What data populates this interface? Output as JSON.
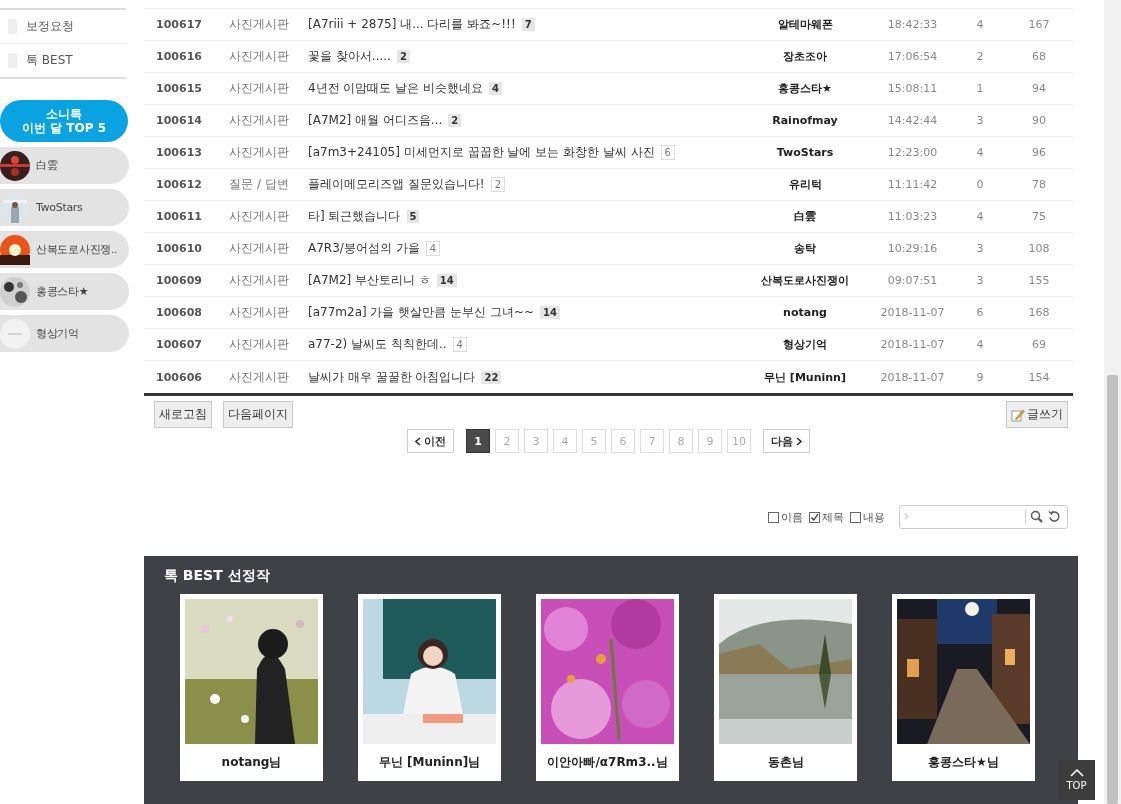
{
  "sidebar": {
    "menu": [
      {
        "label": "보정요청"
      },
      {
        "label": "톡 BEST"
      }
    ],
    "top5": {
      "title_line1": "소니톡",
      "title_line2": "이번 달 TOP 5",
      "members": [
        {
          "name": "白雲"
        },
        {
          "name": "TwoStars"
        },
        {
          "name": "산복도로사진쟁.."
        },
        {
          "name": "홍콩스타★"
        },
        {
          "name": "형상기억"
        }
      ]
    }
  },
  "board": {
    "rows": [
      {
        "number": "100617",
        "category": "사진게시판",
        "title": "[A7riii + 2875] 내... 다리를 봐죠~!!!",
        "comments": "7",
        "highlight": true,
        "author": "알테마웨폰",
        "time": "18:42:33",
        "votes": "4",
        "views": "167"
      },
      {
        "number": "100616",
        "category": "사진게시판",
        "title": "꽃을 찾아서.....",
        "comments": "2",
        "highlight": true,
        "author": "장초조아",
        "time": "17:06:54",
        "votes": "2",
        "views": "68"
      },
      {
        "number": "100615",
        "category": "사진게시판",
        "title": "4년전 이맘때도 날은 비슷했네요",
        "comments": "4",
        "highlight": true,
        "author": "홍콩스타★",
        "time": "15:08:11",
        "votes": "1",
        "views": "94"
      },
      {
        "number": "100614",
        "category": "사진게시판",
        "title": "[A7M2] 애월 어디즈음...",
        "comments": "2",
        "highlight": true,
        "author": "Rainofmay",
        "time": "14:42:44",
        "votes": "3",
        "views": "90"
      },
      {
        "number": "100613",
        "category": "사진게시판",
        "title": "[a7m3+24105] 미세먼지로 꿉꿉한 날에 보는 화창한 날씨 사진",
        "comments": "6",
        "highlight": false,
        "author": "TwoStars",
        "time": "12:23:00",
        "votes": "4",
        "views": "96"
      },
      {
        "number": "100612",
        "category": "질문 / 답변",
        "title": "플레이메모리즈앱 질문있습니다!",
        "comments": "2",
        "highlight": false,
        "author": "유리턱",
        "time": "11:11:42",
        "votes": "0",
        "views": "78"
      },
      {
        "number": "100611",
        "category": "사진게시판",
        "title": "타] 퇴근했습니다",
        "comments": "5",
        "highlight": true,
        "author": "白雲",
        "time": "11:03:23",
        "votes": "4",
        "views": "75"
      },
      {
        "number": "100610",
        "category": "사진게시판",
        "title": "A7R3/붕어섬의 가을",
        "comments": "4",
        "highlight": false,
        "author": "송탁",
        "time": "10:29:16",
        "votes": "3",
        "views": "108"
      },
      {
        "number": "100609",
        "category": "사진게시판",
        "title": "[A7M2] 부산토리니 ㅎ",
        "comments": "14",
        "highlight": true,
        "author": "산복도로사진쟁이",
        "time": "09:07:51",
        "votes": "3",
        "views": "155"
      },
      {
        "number": "100608",
        "category": "사진게시판",
        "title": "[a77m2a] 가을 햇살만큼 눈부신 그녀~~",
        "comments": "14",
        "highlight": true,
        "author": "notang",
        "time": "2018-11-07",
        "votes": "6",
        "views": "168"
      },
      {
        "number": "100607",
        "category": "사진게시판",
        "title": "a77-2) 날씨도 칙칙한데..",
        "comments": "4",
        "highlight": false,
        "author": "형상기억",
        "time": "2018-11-07",
        "votes": "4",
        "views": "69"
      },
      {
        "number": "100606",
        "category": "사진게시판",
        "title": "날씨가 매우 꿀꿀한 아침입니다",
        "comments": "22",
        "highlight": true,
        "author": "무닌 [Muninn]",
        "time": "2018-11-07",
        "votes": "9",
        "views": "154"
      }
    ]
  },
  "actions": {
    "left": [
      "새로고침",
      "다음페이지"
    ],
    "write": "글쓰기"
  },
  "pagination": {
    "prev": "이전",
    "next": "다음",
    "pages": [
      {
        "label": "1",
        "selected": true
      },
      {
        "label": "2",
        "selected": false
      },
      {
        "label": "3",
        "selected": false
      },
      {
        "label": "4",
        "selected": false
      },
      {
        "label": "5",
        "selected": false
      },
      {
        "label": "6",
        "selected": false
      },
      {
        "label": "7",
        "selected": false
      },
      {
        "label": "8",
        "selected": false
      },
      {
        "label": "9",
        "selected": false
      },
      {
        "label": "10",
        "selected": false
      }
    ]
  },
  "search": {
    "options": [
      {
        "label": "이름",
        "checked": false
      },
      {
        "label": "제목",
        "checked": true
      },
      {
        "label": "내용",
        "checked": false
      }
    ]
  },
  "best": {
    "title": "톡 BEST 선정작",
    "items": [
      {
        "caption": "notang님"
      },
      {
        "caption": "무닌 [Muninn]님"
      },
      {
        "caption": "이안아빠/α7Rm3..님"
      },
      {
        "caption": "동촌님"
      },
      {
        "caption": "홍콩스타★님"
      }
    ]
  },
  "top_button": "TOP"
}
